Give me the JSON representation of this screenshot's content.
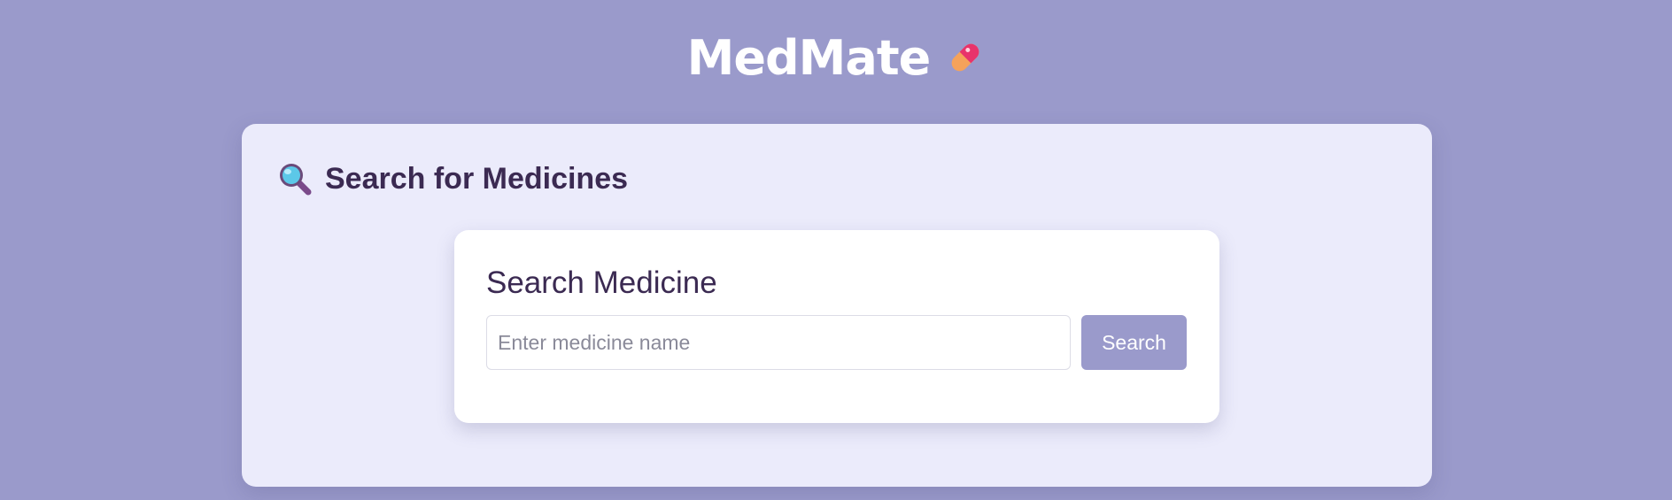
{
  "header": {
    "title": "MedMate",
    "icon": "pill-icon"
  },
  "main": {
    "section_title": "Search for Medicines",
    "section_icon": "magnifier-icon",
    "search_card": {
      "title": "Search Medicine",
      "input_value": "",
      "input_placeholder": "Enter medicine name",
      "button_label": "Search"
    }
  },
  "colors": {
    "background": "#9a9acb",
    "card_background": "#ebebfb",
    "heading_text": "#3b2a52",
    "button": "#9a9acb"
  }
}
